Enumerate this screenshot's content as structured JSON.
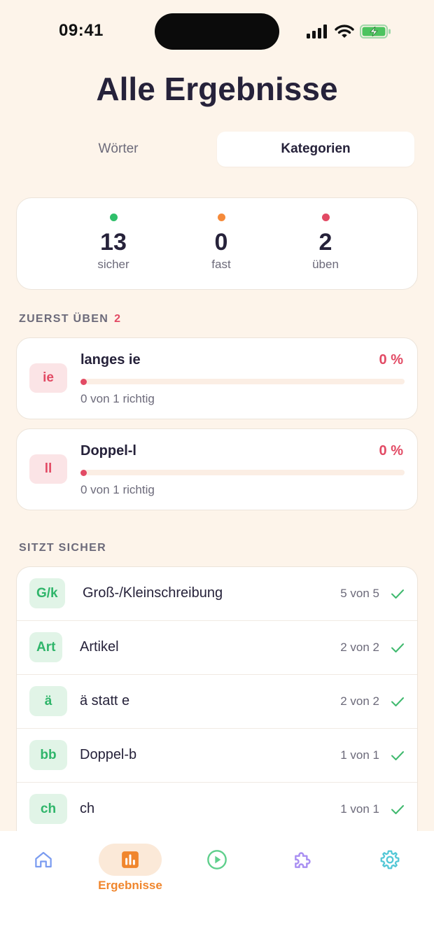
{
  "status_bar": {
    "time": "09:41"
  },
  "title": "Alle Ergebnisse",
  "tabs": [
    {
      "label": "Wörter",
      "active": false
    },
    {
      "label": "Kategorien",
      "active": true
    }
  ],
  "summary": [
    {
      "count": "13",
      "label": "sicher",
      "color": "#2fbf6a"
    },
    {
      "count": "0",
      "label": "fast",
      "color": "#f58a3a"
    },
    {
      "count": "2",
      "label": "üben",
      "color": "#e24a64"
    }
  ],
  "practice_section": {
    "title": "ZUERST ÜBEN",
    "count": "2"
  },
  "practice_items": [
    {
      "badge": "ie",
      "name": "langes ie",
      "percent": "0 %",
      "progress": 0,
      "detail": "0 von 1 richtig"
    },
    {
      "badge": "ll",
      "name": "Doppel-l",
      "percent": "0 %",
      "progress": 0,
      "detail": "0 von 1 richtig"
    }
  ],
  "mastered_section": {
    "title": "SITZT SICHER"
  },
  "mastered_items": [
    {
      "badge": "G/k",
      "name": "Groß-/Kleinschreibung",
      "count": "5 von 5"
    },
    {
      "badge": "Art",
      "name": "Artikel",
      "count": "2 von 2"
    },
    {
      "badge": "ä",
      "name": "ä statt e",
      "count": "2 von 2"
    },
    {
      "badge": "bb",
      "name": "Doppel-b",
      "count": "1 von 1"
    },
    {
      "badge": "ch",
      "name": "ch",
      "count": "1 von 1"
    }
  ],
  "nav": [
    {
      "icon": "home-icon",
      "label": "",
      "color": "#7b9cf0"
    },
    {
      "icon": "bar-chart-icon",
      "label": "Ergebnisse",
      "color": "#f0862d",
      "active": true
    },
    {
      "icon": "play-icon",
      "label": "",
      "color": "#5fcf8c"
    },
    {
      "icon": "puzzle-icon",
      "label": "",
      "color": "#a98ff2"
    },
    {
      "icon": "gear-icon",
      "label": "",
      "color": "#52c7d6"
    }
  ]
}
